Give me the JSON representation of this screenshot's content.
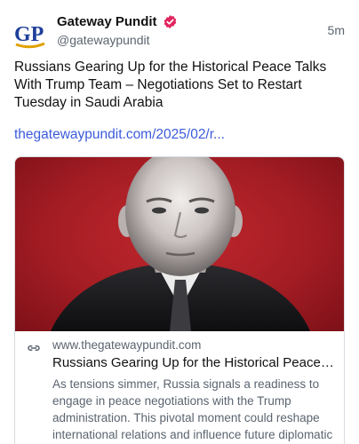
{
  "author": {
    "logo_text": "GP",
    "display_name": "Gateway Pundit",
    "handle": "@gatewaypundit",
    "verified": true
  },
  "post": {
    "time": "5m",
    "text": "Russians Gearing Up for the Historical Peace Talks With Trump Team – Negotiations Set to Restart Tuesday in Saudi Arabia",
    "link_text": "thegatewaypundit.com/2025/02/r..."
  },
  "card": {
    "icon": "link-icon",
    "domain": "www.thegatewaypundit.com",
    "title": "Russians Gearing Up for the Historical Peace T...",
    "description": "As tensions simmer, Russia signals a readiness to engage in peace negotiations with the Trump administration. This pivotal moment could reshape international relations and influence future diplomatic ..."
  },
  "colors": {
    "logo_blue": "#1f3f9a",
    "logo_gold": "#e0a100",
    "verified_badge": "#e0245e",
    "link": "#3b5bdb",
    "card_image_bg": "#c1272d"
  }
}
